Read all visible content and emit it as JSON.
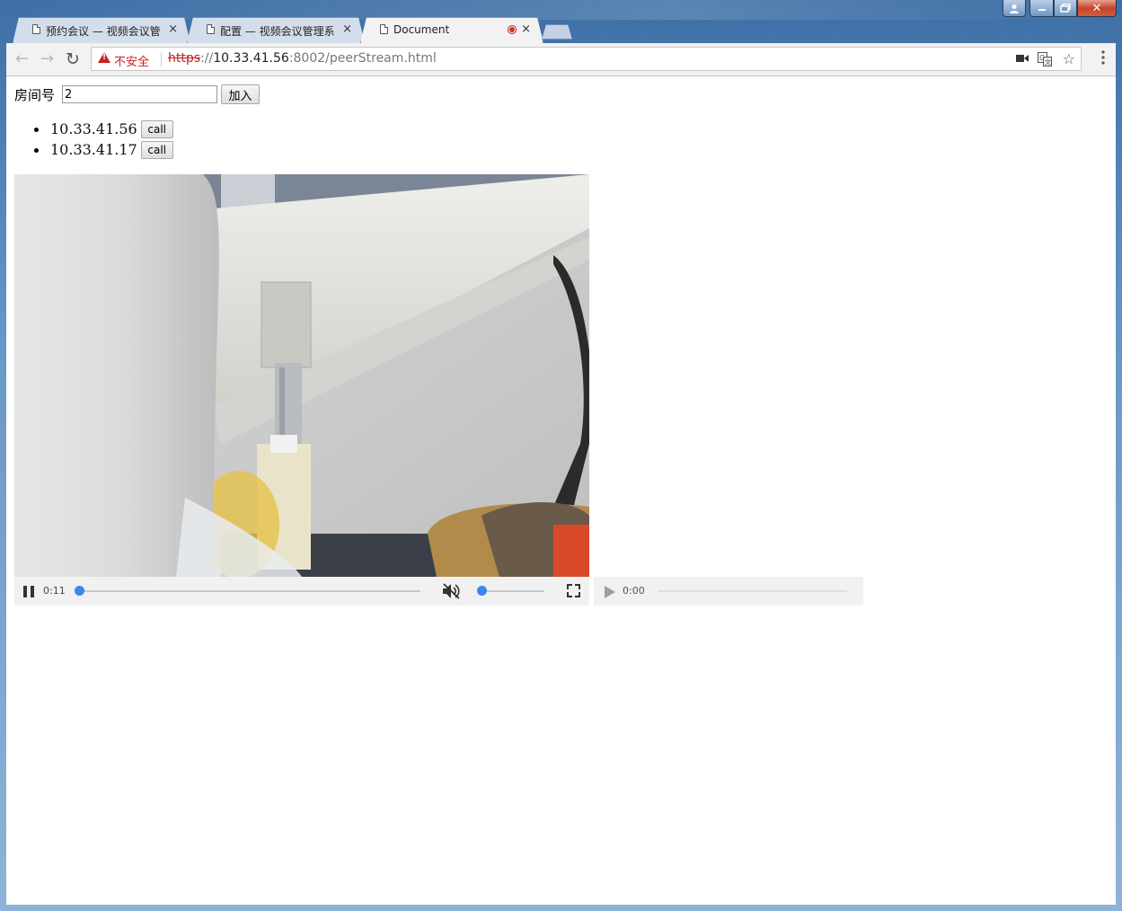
{
  "window": {
    "tabs": [
      {
        "title": "预约会议 — 视频会议管",
        "close_glyph": "×"
      },
      {
        "title": "配置 — 视频会议管理系",
        "close_glyph": "×"
      },
      {
        "title": "Document",
        "close_glyph": "×",
        "recording": true
      }
    ]
  },
  "toolbar": {
    "security_label": "不安全",
    "url_scheme": "https",
    "url_sep": "://",
    "url_host": "10.33.41.56",
    "url_rest": ":8002/peerStream.html",
    "icons": [
      "back-arrow-icon",
      "forward-arrow-icon",
      "reload-icon",
      "camera-icon",
      "translate-icon",
      "star-icon",
      "menu-icon"
    ]
  },
  "page": {
    "room_label": "房间号",
    "room_value": "2",
    "join_label": "加入",
    "peers": [
      {
        "ip": "10.33.41.56",
        "action": "call"
      },
      {
        "ip": "10.33.41.17",
        "action": "call"
      }
    ]
  },
  "local_video": {
    "time": "0:11",
    "progress_fraction": 0.0,
    "volume_fraction": 0.0,
    "muted": true,
    "playing": true
  },
  "remote_video": {
    "time": "0:00",
    "playing": false
  },
  "colors": {
    "accent": "#3d86ee",
    "insecure": "#c5221f"
  }
}
